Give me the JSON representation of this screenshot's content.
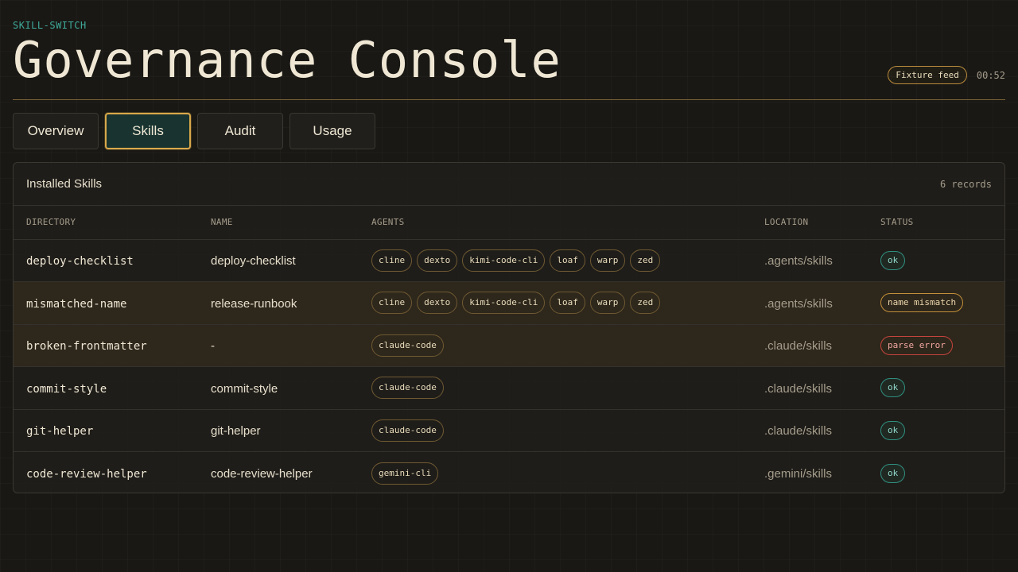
{
  "brand": "SKILL-SWITCH",
  "title": "Governance Console",
  "header": {
    "feed_label": "Fixture feed",
    "clock": "00:52"
  },
  "tabs": [
    {
      "label": "Overview",
      "active": false
    },
    {
      "label": "Skills",
      "active": true
    },
    {
      "label": "Audit",
      "active": false
    },
    {
      "label": "Usage",
      "active": false
    }
  ],
  "panel": {
    "title": "Installed Skills",
    "record_count": "6 records",
    "columns": [
      "DIRECTORY",
      "NAME",
      "AGENTS",
      "LOCATION",
      "STATUS"
    ],
    "rows": [
      {
        "directory": "deploy-checklist",
        "name": "deploy-checklist",
        "agents": [
          "cline",
          "dexto",
          "kimi-code-cli",
          "loaf",
          "warp",
          "zed"
        ],
        "location": ".agents/skills",
        "status": "ok",
        "status_kind": "ok"
      },
      {
        "directory": "mismatched-name",
        "name": "release-runbook",
        "agents": [
          "cline",
          "dexto",
          "kimi-code-cli",
          "loaf",
          "warp",
          "zed"
        ],
        "location": ".agents/skills",
        "status": "name mismatch",
        "status_kind": "mismatch"
      },
      {
        "directory": "broken-frontmatter",
        "name": "-",
        "agents": [
          "claude-code"
        ],
        "location": ".claude/skills",
        "status": "parse error",
        "status_kind": "error"
      },
      {
        "directory": "commit-style",
        "name": "commit-style",
        "agents": [
          "claude-code"
        ],
        "location": ".claude/skills",
        "status": "ok",
        "status_kind": "ok"
      },
      {
        "directory": "git-helper",
        "name": "git-helper",
        "agents": [
          "claude-code"
        ],
        "location": ".claude/skills",
        "status": "ok",
        "status_kind": "ok"
      },
      {
        "directory": "code-review-helper",
        "name": "code-review-helper",
        "agents": [
          "gemini-cli"
        ],
        "location": ".gemini/skills",
        "status": "ok",
        "status_kind": "ok"
      }
    ]
  },
  "colors": {
    "accent": "#d9a84a",
    "teal": "#3fa99a",
    "background": "#191814",
    "error": "#c5443d"
  }
}
